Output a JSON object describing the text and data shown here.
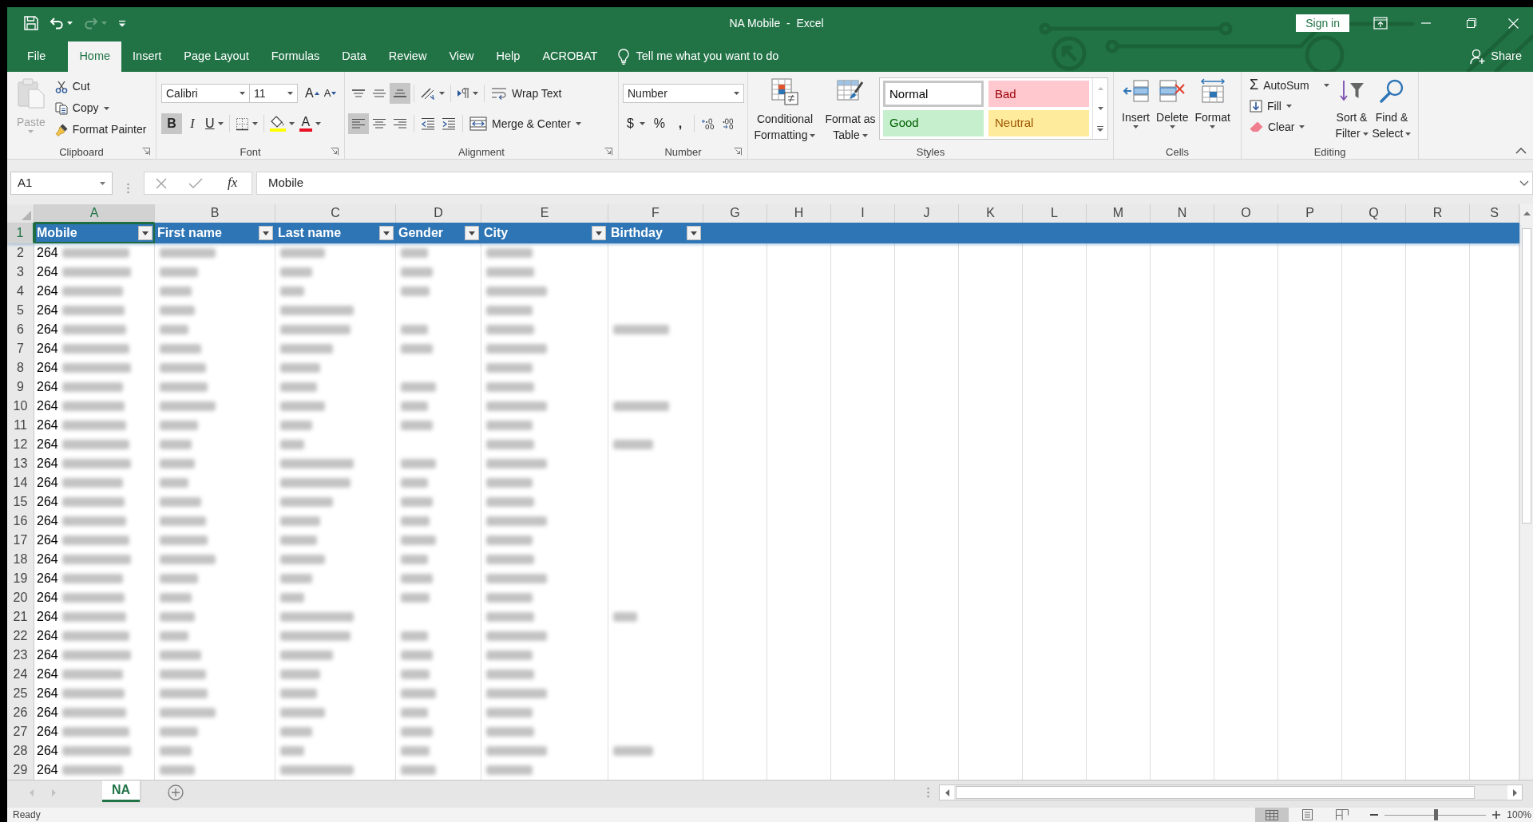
{
  "title_bar": {
    "title": "NA Mobile  -  Excel",
    "sign_in": "Sign in",
    "quick_access": [
      {
        "kind": "save",
        "disabled": false,
        "dropdown": false
      },
      {
        "kind": "undo",
        "disabled": false,
        "dropdown": true
      },
      {
        "kind": "redo",
        "disabled": true,
        "dropdown": true
      },
      {
        "kind": "customize",
        "disabled": false,
        "dropdown": false
      }
    ]
  },
  "menu_tabs": [
    {
      "label": "File",
      "selected": false
    },
    {
      "label": "Home",
      "selected": true
    },
    {
      "label": "Insert",
      "selected": false
    },
    {
      "label": "Page Layout",
      "selected": false
    },
    {
      "label": "Formulas",
      "selected": false
    },
    {
      "label": "Data",
      "selected": false
    },
    {
      "label": "Review",
      "selected": false
    },
    {
      "label": "View",
      "selected": false
    },
    {
      "label": "Help",
      "selected": false
    },
    {
      "label": "ACROBAT",
      "selected": false
    }
  ],
  "tell_me": "Tell me what you want to do",
  "share": "Share",
  "ribbon": {
    "clipboard": {
      "label": "Clipboard",
      "launcher": true,
      "paste": {
        "label": "Paste",
        "disabled": true
      },
      "commands": [
        {
          "kind": "cut",
          "label": "Cut",
          "dropdown": false
        },
        {
          "kind": "copy",
          "label": "Copy",
          "dropdown": true
        },
        {
          "kind": "format_painter",
          "label": "Format Painter",
          "dropdown": false
        }
      ]
    },
    "font": {
      "label": "Font",
      "launcher": true,
      "font_name": "Calibri",
      "font_size": "11",
      "grow": "A",
      "shrink": "A",
      "styles": [
        {
          "kind": "bold",
          "label": "B",
          "selected": true
        },
        {
          "kind": "italic",
          "label": "I",
          "selected": false
        },
        {
          "kind": "underline",
          "label": "U",
          "selected": false
        }
      ],
      "font_color": "A"
    },
    "alignment": {
      "label": "Alignment",
      "launcher": true,
      "vertical": [
        {
          "kind": "top",
          "selected": false
        },
        {
          "kind": "middle",
          "selected": false
        },
        {
          "kind": "bottom",
          "selected": true
        }
      ],
      "horizontal": [
        {
          "kind": "left",
          "selected": true
        },
        {
          "kind": "center",
          "selected": false
        },
        {
          "kind": "right",
          "selected": false
        }
      ],
      "wrap_text": "Wrap Text",
      "merge": "Merge & Center"
    },
    "number": {
      "label": "Number",
      "launcher": true,
      "format": "Number",
      "currency": "$",
      "percent": "%",
      "comma": ","
    },
    "styles": {
      "label": "Styles",
      "conditional": "Conditional Formatting",
      "format_table": "Format as Table",
      "gallery": [
        {
          "label": "Normal",
          "kind": "normal",
          "selected": true
        },
        {
          "label": "Bad",
          "kind": "bad",
          "selected": false
        },
        {
          "label": "Good",
          "kind": "good",
          "selected": false
        },
        {
          "label": "Neutral",
          "kind": "neutral",
          "selected": false
        }
      ]
    },
    "cells": {
      "label": "Cells",
      "commands": [
        {
          "kind": "insert",
          "label": "Insert"
        },
        {
          "kind": "delete",
          "label": "Delete"
        },
        {
          "kind": "format",
          "label": "Format"
        }
      ]
    },
    "editing": {
      "label": "Editing",
      "commands": [
        {
          "kind": "autosum",
          "icon": "Σ",
          "label": "AutoSum"
        },
        {
          "kind": "fill",
          "label": "Fill"
        },
        {
          "kind": "clear",
          "label": "Clear"
        }
      ],
      "big": [
        {
          "kind": "sort",
          "label": "Sort & Filter"
        },
        {
          "kind": "find",
          "label": "Find & Select"
        }
      ]
    }
  },
  "formula_bar": {
    "name_box": "A1",
    "function_label": "fx",
    "formula": "Mobile"
  },
  "sheet": {
    "columns": [
      {
        "label": "A",
        "selected": true
      },
      {
        "label": "B",
        "selected": false
      },
      {
        "label": "C",
        "selected": false
      },
      {
        "label": "D",
        "selected": false
      },
      {
        "label": "E",
        "selected": false
      },
      {
        "label": "F",
        "selected": false
      },
      {
        "label": "G",
        "selected": false
      },
      {
        "label": "H",
        "selected": false
      },
      {
        "label": "I",
        "selected": false
      },
      {
        "label": "J",
        "selected": false
      },
      {
        "label": "K",
        "selected": false
      },
      {
        "label": "L",
        "selected": false
      },
      {
        "label": "M",
        "selected": false
      },
      {
        "label": "N",
        "selected": false
      },
      {
        "label": "O",
        "selected": false
      },
      {
        "label": "P",
        "selected": false
      },
      {
        "label": "Q",
        "selected": false
      },
      {
        "label": "R",
        "selected": false
      },
      {
        "label": "S",
        "selected": false
      }
    ],
    "rows": [
      {
        "number": "1",
        "selected": true,
        "kind": "header",
        "cells": [
          {
            "text": "Mobile",
            "selected": true,
            "filter": true
          },
          {
            "text": "First name",
            "selected": false,
            "filter": true
          },
          {
            "text": "Last name",
            "selected": false,
            "filter": true
          },
          {
            "text": "Gender",
            "selected": false,
            "filter": true
          },
          {
            "text": "City",
            "selected": false,
            "filter": true
          },
          {
            "text": "Birthday",
            "selected": false,
            "filter": true
          }
        ]
      },
      {
        "number": "2",
        "selected": false,
        "kind": "data",
        "mobile": "264",
        "redacted": [
          true,
          true,
          true,
          true,
          true,
          false
        ]
      },
      {
        "number": "3",
        "selected": false,
        "kind": "data",
        "mobile": "264",
        "redacted": [
          true,
          true,
          true,
          true,
          true,
          false
        ]
      },
      {
        "number": "4",
        "selected": false,
        "kind": "data",
        "mobile": "264",
        "redacted": [
          true,
          true,
          true,
          true,
          true,
          false
        ]
      },
      {
        "number": "5",
        "selected": false,
        "kind": "data",
        "mobile": "264",
        "redacted": [
          true,
          true,
          true,
          false,
          true,
          false
        ]
      },
      {
        "number": "6",
        "selected": false,
        "kind": "data",
        "mobile": "264",
        "redacted": [
          true,
          true,
          true,
          true,
          true,
          true
        ]
      },
      {
        "number": "7",
        "selected": false,
        "kind": "data",
        "mobile": "264",
        "redacted": [
          true,
          true,
          true,
          true,
          true,
          false
        ]
      },
      {
        "number": "8",
        "selected": false,
        "kind": "data",
        "mobile": "264",
        "redacted": [
          true,
          true,
          true,
          false,
          true,
          false
        ]
      },
      {
        "number": "9",
        "selected": false,
        "kind": "data",
        "mobile": "264",
        "redacted": [
          true,
          true,
          true,
          true,
          true,
          false
        ]
      },
      {
        "number": "10",
        "selected": false,
        "kind": "data",
        "mobile": "264",
        "redacted": [
          true,
          true,
          true,
          true,
          true,
          true
        ]
      },
      {
        "number": "11",
        "selected": false,
        "kind": "data",
        "mobile": "264",
        "redacted": [
          true,
          true,
          true,
          true,
          true,
          false
        ]
      },
      {
        "number": "12",
        "selected": false,
        "kind": "data",
        "mobile": "264",
        "redacted": [
          true,
          true,
          true,
          false,
          true,
          true
        ]
      },
      {
        "number": "13",
        "selected": false,
        "kind": "data",
        "mobile": "264",
        "redacted": [
          true,
          true,
          true,
          true,
          true,
          false
        ]
      },
      {
        "number": "14",
        "selected": false,
        "kind": "data",
        "mobile": "264",
        "redacted": [
          true,
          true,
          true,
          true,
          true,
          false
        ]
      },
      {
        "number": "15",
        "selected": false,
        "kind": "data",
        "mobile": "264",
        "redacted": [
          true,
          true,
          true,
          true,
          true,
          false
        ]
      },
      {
        "number": "16",
        "selected": false,
        "kind": "data",
        "mobile": "264",
        "redacted": [
          true,
          true,
          true,
          true,
          true,
          false
        ]
      },
      {
        "number": "17",
        "selected": false,
        "kind": "data",
        "mobile": "264",
        "redacted": [
          true,
          true,
          true,
          true,
          true,
          false
        ]
      },
      {
        "number": "18",
        "selected": false,
        "kind": "data",
        "mobile": "264",
        "redacted": [
          true,
          true,
          true,
          true,
          true,
          false
        ]
      },
      {
        "number": "19",
        "selected": false,
        "kind": "data",
        "mobile": "264",
        "redacted": [
          true,
          true,
          true,
          true,
          true,
          false
        ]
      },
      {
        "number": "20",
        "selected": false,
        "kind": "data",
        "mobile": "264",
        "redacted": [
          true,
          true,
          true,
          true,
          true,
          false
        ]
      },
      {
        "number": "21",
        "selected": false,
        "kind": "data",
        "mobile": "264",
        "redacted": [
          true,
          true,
          true,
          false,
          true,
          true
        ]
      },
      {
        "number": "22",
        "selected": false,
        "kind": "data",
        "mobile": "264",
        "redacted": [
          true,
          true,
          true,
          true,
          true,
          false
        ]
      },
      {
        "number": "23",
        "selected": false,
        "kind": "data",
        "mobile": "264",
        "redacted": [
          true,
          true,
          true,
          true,
          true,
          false
        ]
      },
      {
        "number": "24",
        "selected": false,
        "kind": "data",
        "mobile": "264",
        "redacted": [
          true,
          true,
          true,
          true,
          true,
          false
        ]
      },
      {
        "number": "25",
        "selected": false,
        "kind": "data",
        "mobile": "264",
        "redacted": [
          true,
          true,
          true,
          true,
          true,
          false
        ]
      },
      {
        "number": "26",
        "selected": false,
        "kind": "data",
        "mobile": "264",
        "redacted": [
          true,
          true,
          true,
          true,
          true,
          false
        ]
      },
      {
        "number": "27",
        "selected": false,
        "kind": "data",
        "mobile": "264",
        "redacted": [
          true,
          true,
          true,
          true,
          true,
          false
        ]
      },
      {
        "number": "28",
        "selected": false,
        "kind": "data",
        "mobile": "264",
        "redacted": [
          true,
          true,
          true,
          true,
          true,
          true
        ]
      },
      {
        "number": "29",
        "selected": false,
        "kind": "data",
        "mobile": "264",
        "redacted": [
          true,
          true,
          true,
          true,
          true,
          false
        ]
      }
    ]
  },
  "sheet_tabs": [
    {
      "label": "NA",
      "selected": true
    }
  ],
  "status_bar": {
    "text": "Ready",
    "views": [
      {
        "kind": "normal",
        "selected": true
      },
      {
        "kind": "page_layout",
        "selected": false
      },
      {
        "kind": "page_break",
        "selected": false
      }
    ],
    "zoom": {
      "level": 0.5,
      "reading": "100%"
    }
  }
}
